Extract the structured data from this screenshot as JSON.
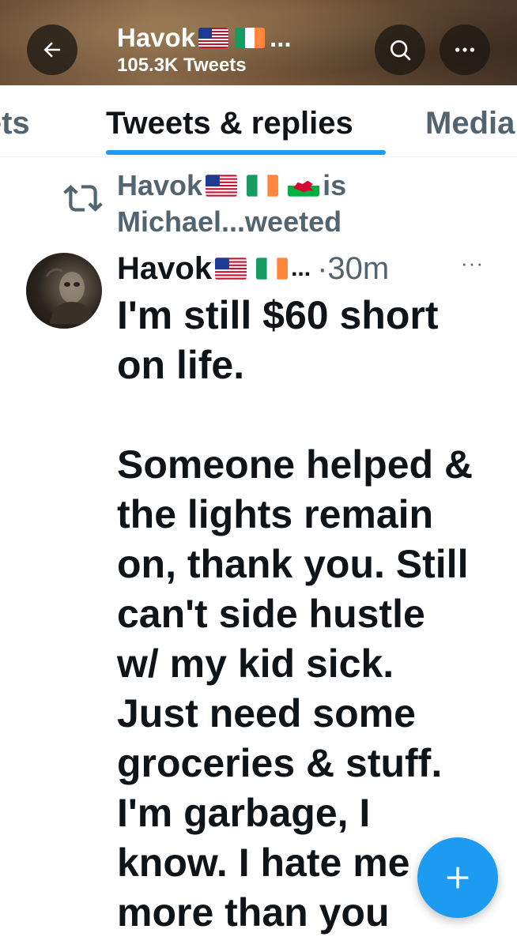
{
  "header": {
    "name": "Havok",
    "ellipsis": "...",
    "tweet_count": "105.3K Tweets",
    "icons": {
      "back": "arrow-left-icon",
      "search": "search-icon",
      "more": "more-horizontal-icon"
    }
  },
  "tabs": [
    {
      "label": "Tweets",
      "active": false
    },
    {
      "label": "Tweets & replies",
      "active": true
    },
    {
      "label": "Media",
      "active": false
    }
  ],
  "retweet_context": {
    "name": "Havok",
    "suffix": "is",
    "line2": "Michael...weeted",
    "icon": "retweet-icon"
  },
  "tweet": {
    "author": "Havok",
    "author_ellipsis": "...",
    "time": "·30m",
    "more": "···",
    "paragraph1": "I'm still $60 short\non life.",
    "paragraph2": "Someone helped &\nthe lights remain\non, thank you. Still\ncan't side hustle\nw/ my kid sick.\nJust need some\ngroceries & stuff.\nI'm garbage, I\nknow. I hate me\nmore than you"
  },
  "fab": {
    "icon": "plus-icon"
  },
  "colors": {
    "accent": "#1d9bf0",
    "text_primary": "#0f1419",
    "text_secondary": "#536471"
  }
}
